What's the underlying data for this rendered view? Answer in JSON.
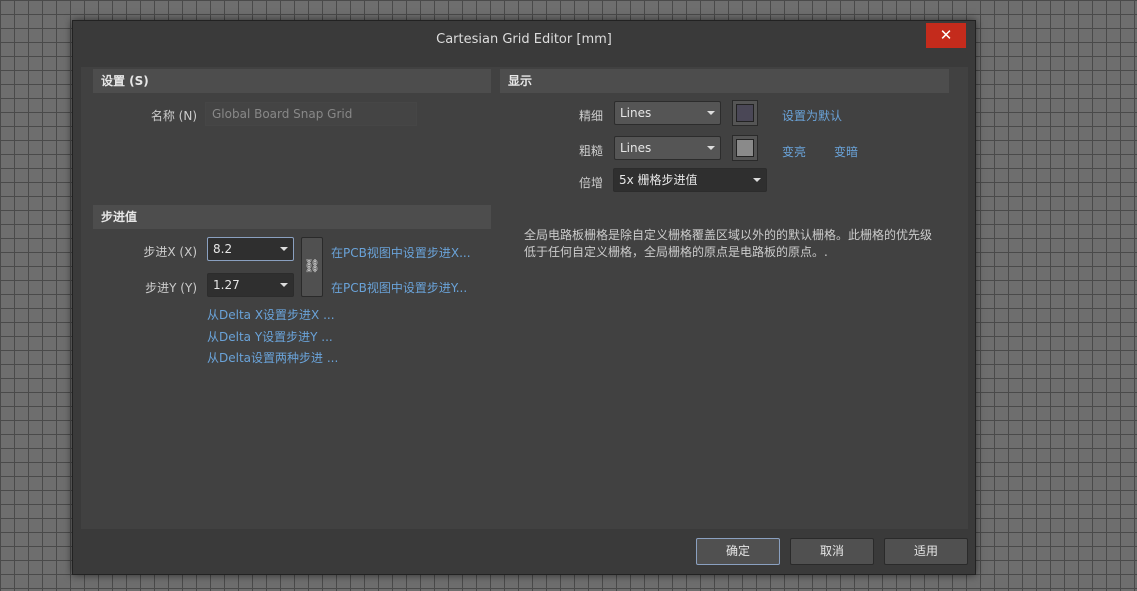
{
  "dialog": {
    "title": "Cartesian Grid Editor [mm]",
    "close": "✕"
  },
  "settings": {
    "header": "设置 (S)",
    "name_label": "名称 (N)",
    "name_value": "Global Board Snap Grid"
  },
  "step": {
    "header": "步进值",
    "x_label": "步进X (X)",
    "x_value": "8.2",
    "y_label": "步进Y (Y)",
    "y_value": "1.27",
    "link_set_x_pcb": "在PCB视图中设置步进X...",
    "link_set_y_pcb": "在PCB视图中设置步进Y...",
    "link_delta_x": "从Delta X设置步进X ...",
    "link_delta_y": "从Delta Y设置步进Y ...",
    "link_delta_both": "从Delta设置两种步进 ..."
  },
  "display": {
    "header": "显示",
    "fine_label": "精细",
    "fine_value": "Lines",
    "coarse_label": "粗糙",
    "coarse_value": "Lines",
    "multiplier_label": "倍增",
    "multiplier_value": "5x 栅格步进值",
    "set_default": "设置为默认",
    "lighter": "变亮",
    "darker": "变暗",
    "fine_color": "#4a4756",
    "coarse_color": "#8a8a8a",
    "description": "全局电路板栅格是除自定义栅格覆盖区域以外的的默认栅格。此栅格的优先级低于任何自定义栅格，全局栅格的原点是电路板的原点。."
  },
  "footer": {
    "ok": "确定",
    "cancel": "取消",
    "apply": "适用"
  }
}
